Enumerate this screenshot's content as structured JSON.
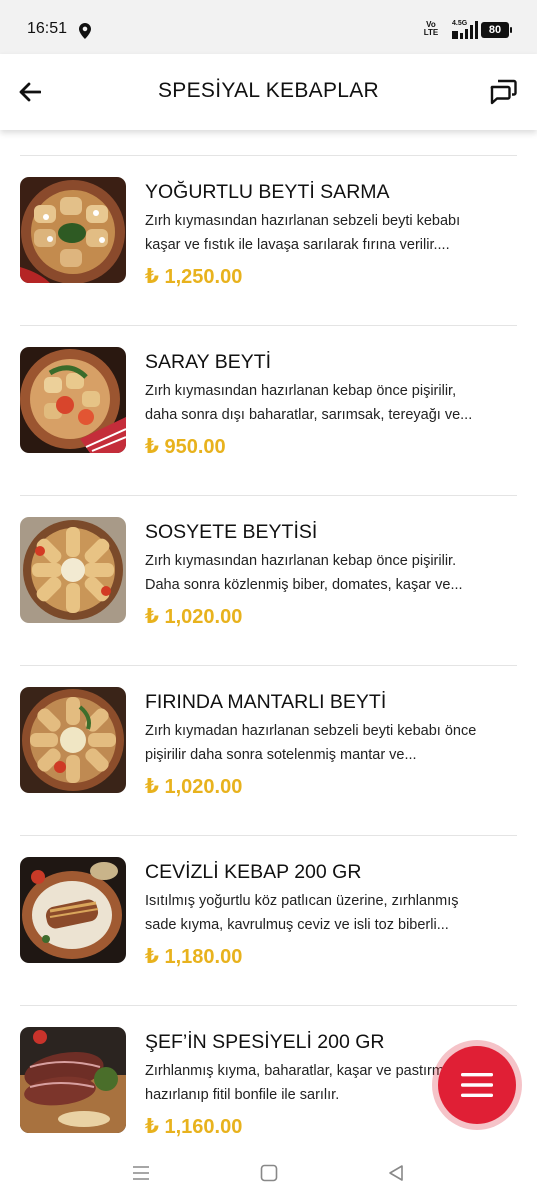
{
  "status_bar": {
    "time": "16:51",
    "network_label": "Vo LTE",
    "signal_label": "4.5G",
    "battery": "80"
  },
  "header": {
    "title": "SPESİYAL KEBAPLAR",
    "back_icon": "arrow-left-icon",
    "chat_icon": "chat-bubbles-icon"
  },
  "currency_symbol": "₺",
  "items": [
    {
      "name": "YOĞURTLU BEYTİ SARMA",
      "description": "Zırh kıymasından hazırlanan sebzeli beyti kebabı kaşar ve fıstık ile lavaşa sarılarak fırına verilir....",
      "price": "₺ 1,250.00"
    },
    {
      "name": "SARAY BEYTİ",
      "description": "Zırh kıymasından hazırlanan kebap önce pişirilir, daha sonra dışı baharatlar, sarımsak, tereyağı ve...",
      "price": "₺ 950.00"
    },
    {
      "name": "SOSYETE BEYTİSİ",
      "description": "Zırh kıymasından hazırlanan kebap önce pişirilir. Daha sonra közlenmiş biber, domates, kaşar ve...",
      "price": "₺ 1,020.00"
    },
    {
      "name": "FIRINDA MANTARLI BEYTİ",
      "description": "Zırh kıymadan hazırlanan sebzeli beyti kebabı önce pişirilir daha sonra sotelenmiş mantar ve...",
      "price": "₺ 1,020.00"
    },
    {
      "name": "CEVİZLİ KEBAP 200 GR",
      "description": "Isıtılmış yoğurtlu köz patlıcan üzerine, zırhlanmış sade kıyma, kavrulmuş ceviz ve isli toz biberli...",
      "price": "₺ 1,180.00"
    },
    {
      "name": "ŞEF’İN SPESİYELİ 200 GR",
      "description": "Zırhlanmış kıyma, baharatlar, kaşar ve pastırma ile hazırlanıp fitil bonfile ile sarılır.",
      "price": "₺ 1,160.00"
    }
  ],
  "fab": {
    "icon": "menu-icon"
  },
  "nav_bar": {
    "recents_icon": "recents-icon",
    "home_icon": "home-icon",
    "back_icon": "back-triangle-icon"
  },
  "colors": {
    "price": "#e8b21d",
    "fab": "#e01f35",
    "divider": "#e4e4e4"
  }
}
